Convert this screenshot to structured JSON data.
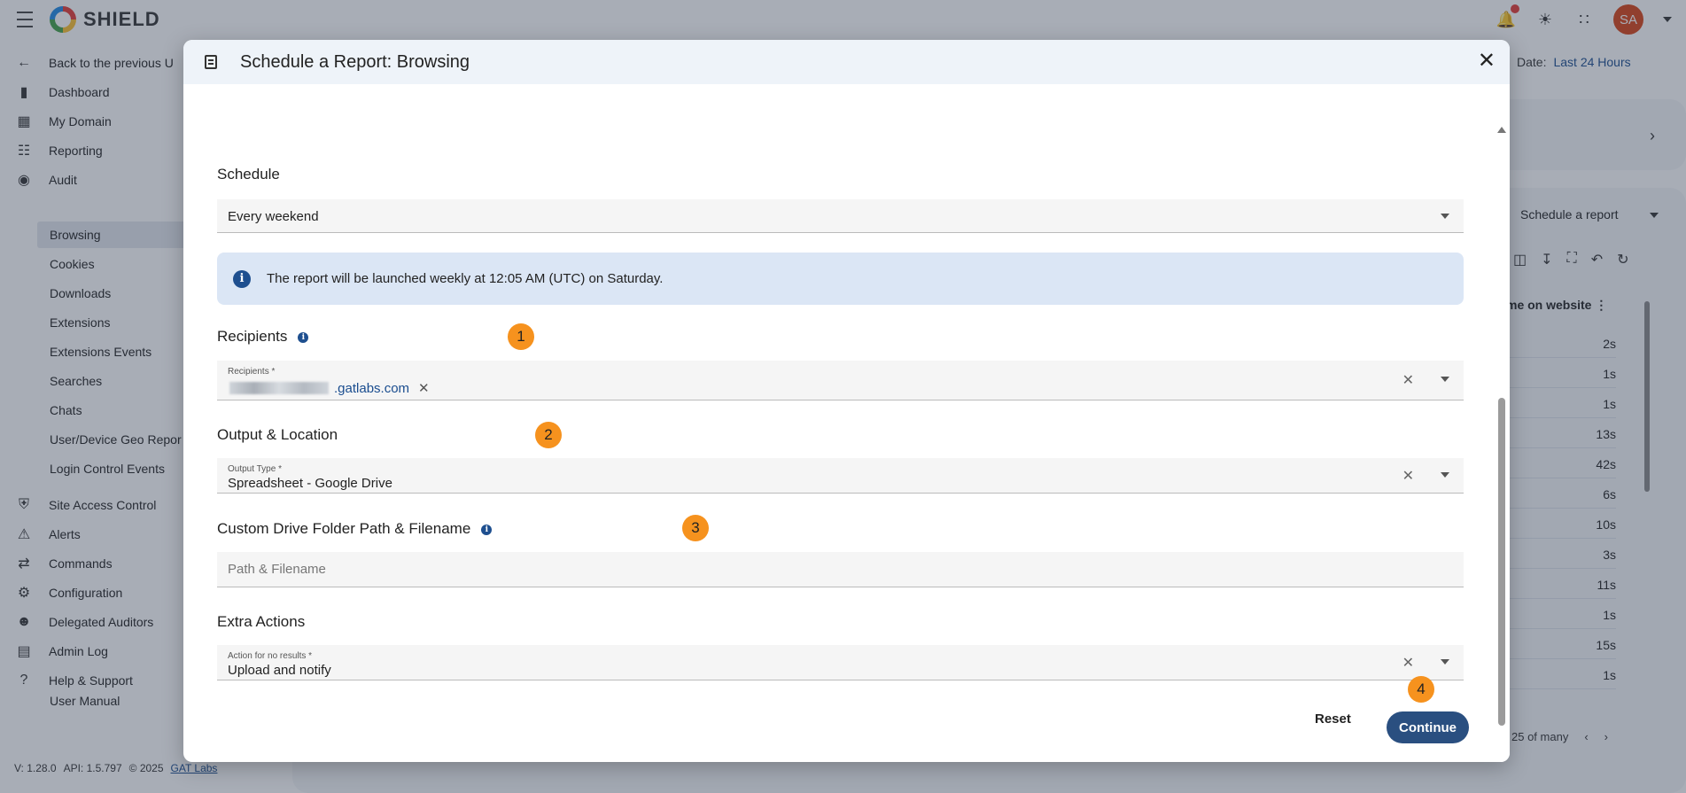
{
  "app": {
    "name": "SHIELD"
  },
  "sidebar": {
    "back_label": "Back to the previous U",
    "items": [
      {
        "label": "Dashboard",
        "icon": "bar-chart-icon"
      },
      {
        "label": "My Domain",
        "icon": "building-icon"
      },
      {
        "label": "Reporting",
        "icon": "clipboard-icon"
      },
      {
        "label": "Audit",
        "icon": "audit-shield-icon"
      }
    ],
    "audit_sub": [
      "Browsing",
      "Cookies",
      "Downloads",
      "Extensions",
      "Extensions Events",
      "Searches",
      "Chats",
      "User/Device Geo Repor",
      "Login Control Events"
    ],
    "items2": [
      {
        "label": "Site Access Control",
        "icon": "shield-icon"
      },
      {
        "label": "Alerts",
        "icon": "alert-shield-icon"
      },
      {
        "label": "Commands",
        "icon": "commands-icon"
      },
      {
        "label": "Configuration",
        "icon": "gear-icon"
      },
      {
        "label": "Delegated Auditors",
        "icon": "people-icon"
      },
      {
        "label": "Admin Log",
        "icon": "log-icon"
      },
      {
        "label": "Help & Support",
        "icon": "help-icon"
      },
      {
        "label": "User Manual",
        "icon": "book-icon"
      }
    ]
  },
  "footer": {
    "version": "V: 1.28.0",
    "api": "API: 1.5.797",
    "copyright": "© 2025",
    "company": "GAT Labs"
  },
  "user": {
    "initials": "SA"
  },
  "background": {
    "date_label": "Date:",
    "date_value": "Last 24 Hours",
    "schedule_button": "Schedule a report",
    "column_header": "me on website",
    "rows": [
      "2s",
      "1s",
      "1s",
      "13s",
      "42s",
      "6s",
      "10s",
      "3s",
      "11s",
      "1s",
      "15s",
      "1s"
    ],
    "pager_text": "25 of many"
  },
  "dialog": {
    "title": "Schedule a Report: Browsing",
    "schedule": {
      "section": "Schedule",
      "value": "Every weekend"
    },
    "info": "The report will be launched weekly at 12:05 AM (UTC) on Saturday.",
    "recipients": {
      "section": "Recipients",
      "label": "Recipients *",
      "chip_domain": ".gatlabs.com"
    },
    "output": {
      "section": "Output & Location",
      "label": "Output Type *",
      "value": "Spreadsheet - Google Drive"
    },
    "custom_path": {
      "section": "Custom Drive Folder Path & Filename",
      "placeholder": "Path & Filename"
    },
    "extra": {
      "section": "Extra Actions",
      "label": "Action for no results *",
      "value": "Upload and notify"
    },
    "steps": [
      "1",
      "2",
      "3",
      "4"
    ],
    "reset_label": "Reset",
    "continue_label": "Continue"
  },
  "colors": {
    "accent": "#2a4f80",
    "badge": "#f6921e",
    "info_bg": "#dbe6f5",
    "avatar": "#d84315"
  }
}
